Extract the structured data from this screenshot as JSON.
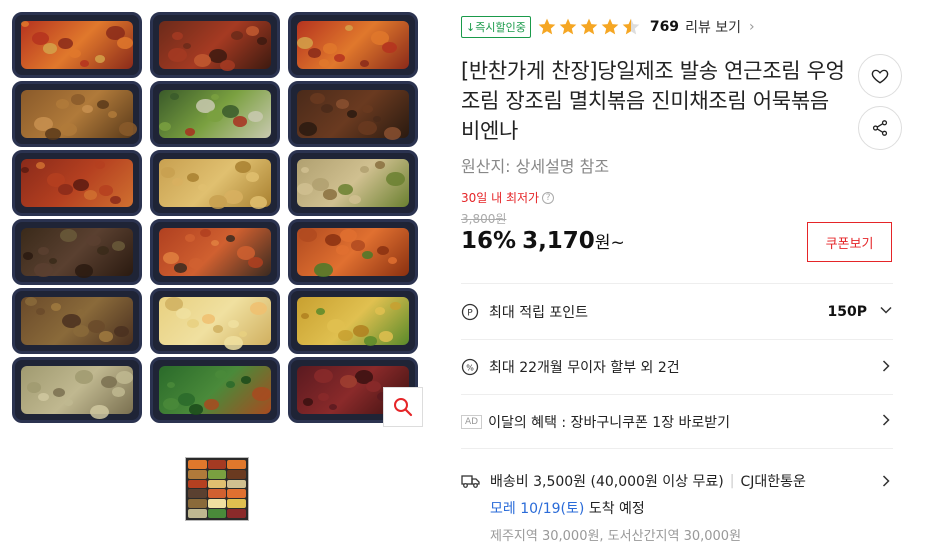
{
  "badge": "↓즉시할인중",
  "rating": {
    "value": 4.5,
    "max": 5,
    "count": "769",
    "link": "리뷰 보기"
  },
  "title": "[반찬가게 찬장]당일제조 발송 연근조림 우엉조림 장조림 멸치볶음 진미채조림 어묵볶음 비엔나",
  "origin": "원산지: 상세설명 참조",
  "lowest_label": "30일 내 최저가",
  "original_price": "3,800원",
  "discount": "16%",
  "price": "3,170",
  "price_unit": "원~",
  "coupon_button": "쿠폰보기",
  "points": {
    "label": "최대 적립 포인트",
    "value": "150P"
  },
  "installment": {
    "label": "최대 22개월 무이자 할부 외 2건"
  },
  "benefit": {
    "ad_tag": "AD",
    "label": "이달의 혜택 : 장바구니쿠폰 1장 바로받기"
  },
  "shipping": {
    "fee": "배송비 3,500원 (40,000원 이상 무료)",
    "carrier": "CJ대한통운",
    "arrival_date": "모레 10/19(토)",
    "arrival_suffix": "도착 예정",
    "extra": "제주지역 30,000원, 도서산간지역 30,000원"
  },
  "colors": {
    "accent_red": "#e52528",
    "star": "#f5a623",
    "badge_green": "#1a9a4a",
    "arrival_blue": "#2a6bd8"
  },
  "icons": [
    "arrow-down-icon",
    "star-icon",
    "chevron-right-icon",
    "heart-icon",
    "share-icon",
    "search-icon",
    "point-icon",
    "percent-icon",
    "truck-icon",
    "chevron-down-icon"
  ]
}
